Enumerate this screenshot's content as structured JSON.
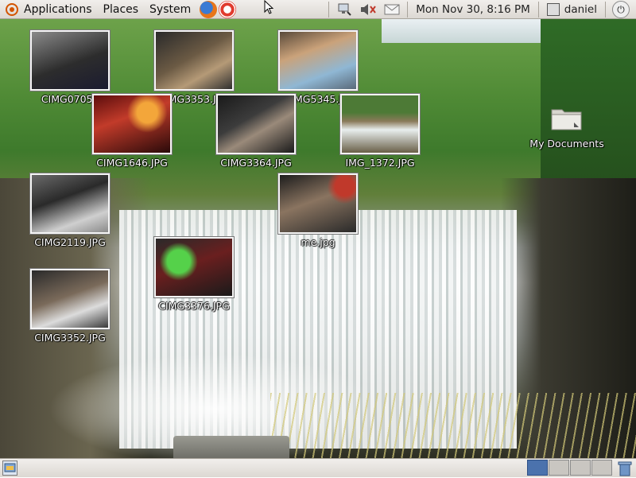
{
  "top_panel": {
    "menus": [
      {
        "label": "Applications"
      },
      {
        "label": "Places"
      },
      {
        "label": "System"
      }
    ],
    "clock": "Mon Nov 30,  8:16 PM",
    "user_name": "daniel"
  },
  "desktop": {
    "icons": [
      {
        "label": "CIMG0705.JPG",
        "display": "CIMG0705.J"
      },
      {
        "label": "CIMG3353.JPG"
      },
      {
        "label": "CIMG5345.JPG",
        "display": "MG5345.J"
      },
      {
        "label": "CIMG1646.JPG"
      },
      {
        "label": "CIMG3364.JPG"
      },
      {
        "label": "IMG_1372.JPG"
      },
      {
        "label": "CIMG2119.JPG"
      },
      {
        "label": "me.jpg"
      },
      {
        "label": "CIMG3376.JPG"
      },
      {
        "label": "CIMG3352.JPG"
      },
      {
        "label": "My Documents"
      }
    ]
  },
  "colors": {
    "panel_bg": "#e6e3de",
    "workspace_active": "#4b72ad"
  },
  "bottom_panel": {
    "workspace_count": 4,
    "active_workspace": 1
  }
}
